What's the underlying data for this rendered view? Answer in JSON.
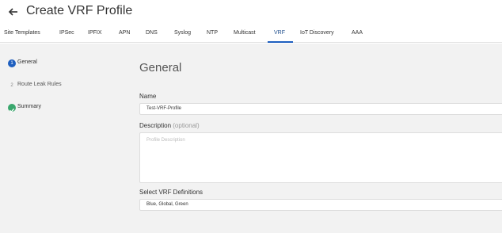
{
  "header": {
    "title": "Create VRF Profile",
    "back_icon": "arrow-left-icon"
  },
  "tabs": [
    {
      "label": "Site Templates"
    },
    {
      "label": "IPSec"
    },
    {
      "label": "IPFIX"
    },
    {
      "label": "APN"
    },
    {
      "label": "DNS"
    },
    {
      "label": "Syslog"
    },
    {
      "label": "NTP"
    },
    {
      "label": "Multicast"
    },
    {
      "label": "VRF",
      "active": true
    },
    {
      "label": "IoT Discovery"
    },
    {
      "label": "AAA"
    }
  ],
  "steps": [
    {
      "label": "General",
      "state": "active",
      "marker": "1"
    },
    {
      "label": "Route Leak Rules",
      "state": "pending",
      "marker": "2"
    },
    {
      "label": "Summary",
      "state": "done",
      "marker": "check-icon"
    }
  ],
  "form": {
    "section_title": "General",
    "name_label": "Name",
    "name_value": "Test-VRF-Profile",
    "description_label": "Description",
    "description_optional": "(optional)",
    "description_placeholder": "Profile Description",
    "vrf_label": "Select VRF Definitions",
    "vrf_value": "Blue, Global, Green"
  },
  "colors": {
    "accent": "#1f5fbf",
    "done": "#3aa76d",
    "panel_bg": "#f2f2f2"
  }
}
